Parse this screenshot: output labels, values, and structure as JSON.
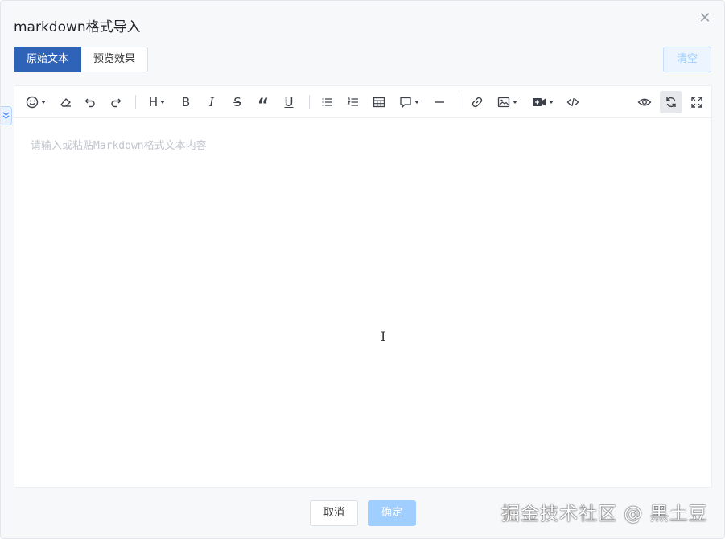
{
  "dialog": {
    "title": "markdown格式导入",
    "close_symbol": "✕"
  },
  "tabs": [
    {
      "label": "原始文本",
      "active": true
    },
    {
      "label": "预览效果",
      "active": false
    }
  ],
  "clear_label": "清空",
  "toolbar": {
    "heading_label": "H",
    "bold_label": "B",
    "italic_label": "I",
    "strike_label": "S",
    "quote_label": "“",
    "underline_label": "U",
    "icons": [
      "emoji-icon",
      "eraser-icon",
      "undo-icon",
      "redo-icon",
      "heading-icon",
      "bold-icon",
      "italic-icon",
      "strikethrough-icon",
      "quote-icon",
      "underline-icon",
      "unordered-list-icon",
      "ordered-list-icon",
      "table-icon",
      "comment-icon",
      "horizontal-rule-icon",
      "link-icon",
      "image-icon",
      "video-icon",
      "code-icon",
      "preview-eye-icon",
      "sync-scroll-icon",
      "fullscreen-icon"
    ]
  },
  "editor": {
    "placeholder": "请输入或粘贴Markdown格式文本内容",
    "value": ""
  },
  "footer": {
    "cancel_label": "取消",
    "ok_label": "确定"
  },
  "watermark": "掘金技术社区 @ 黑土豆",
  "colors": {
    "primary": "#2f63b8",
    "disabled_primary": "#a0cfff",
    "placeholder": "#c0c4cc"
  }
}
